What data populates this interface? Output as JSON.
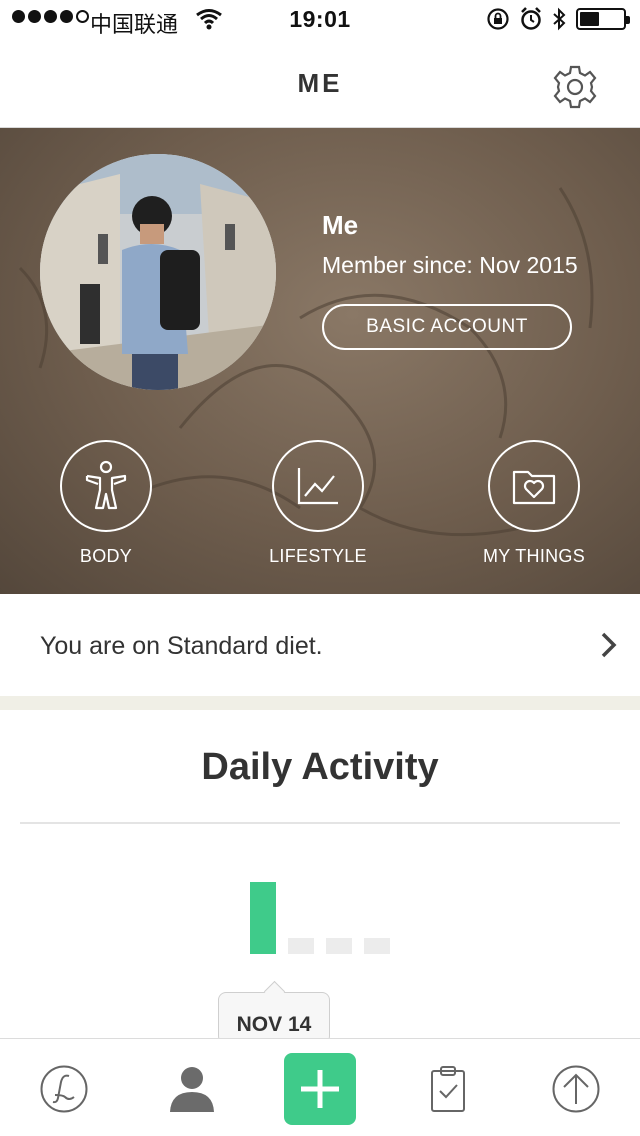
{
  "status_bar": {
    "carrier": "中国联通",
    "time": "19:01",
    "battery_level": 0.45
  },
  "nav": {
    "title": "ME",
    "settings_icon": "gear-icon"
  },
  "profile": {
    "name": "Me",
    "member_since": "Member since: Nov 2015",
    "account_button": "BASIC ACCOUNT"
  },
  "hero_items": [
    {
      "label": "BODY",
      "icon": "body-figure-icon"
    },
    {
      "label": "LIFESTYLE",
      "icon": "line-chart-icon"
    },
    {
      "label": "MY THINGS",
      "icon": "heart-folder-icon"
    }
  ],
  "diet": {
    "text": "You are on Standard diet."
  },
  "activity": {
    "title": "Daily Activity",
    "selected_date": "NOV 14"
  },
  "chart_data": {
    "type": "bar",
    "categories": [
      "NOV 14",
      "",
      "",
      ""
    ],
    "values": [
      1,
      0,
      0,
      0
    ],
    "title": "Daily Activity",
    "highlight_color": "#3fcb8a",
    "empty_color": "#ececec"
  },
  "tab_bar": {
    "items": [
      {
        "icon": "lifesum-logo-icon"
      },
      {
        "icon": "person-icon"
      },
      {
        "icon": "plus-icon"
      },
      {
        "icon": "clipboard-check-icon"
      },
      {
        "icon": "upload-arrow-icon"
      }
    ]
  },
  "colors": {
    "accent": "#3fcb8a",
    "hero_bg": "#6e5d4d",
    "separator": "#f0efe6"
  }
}
